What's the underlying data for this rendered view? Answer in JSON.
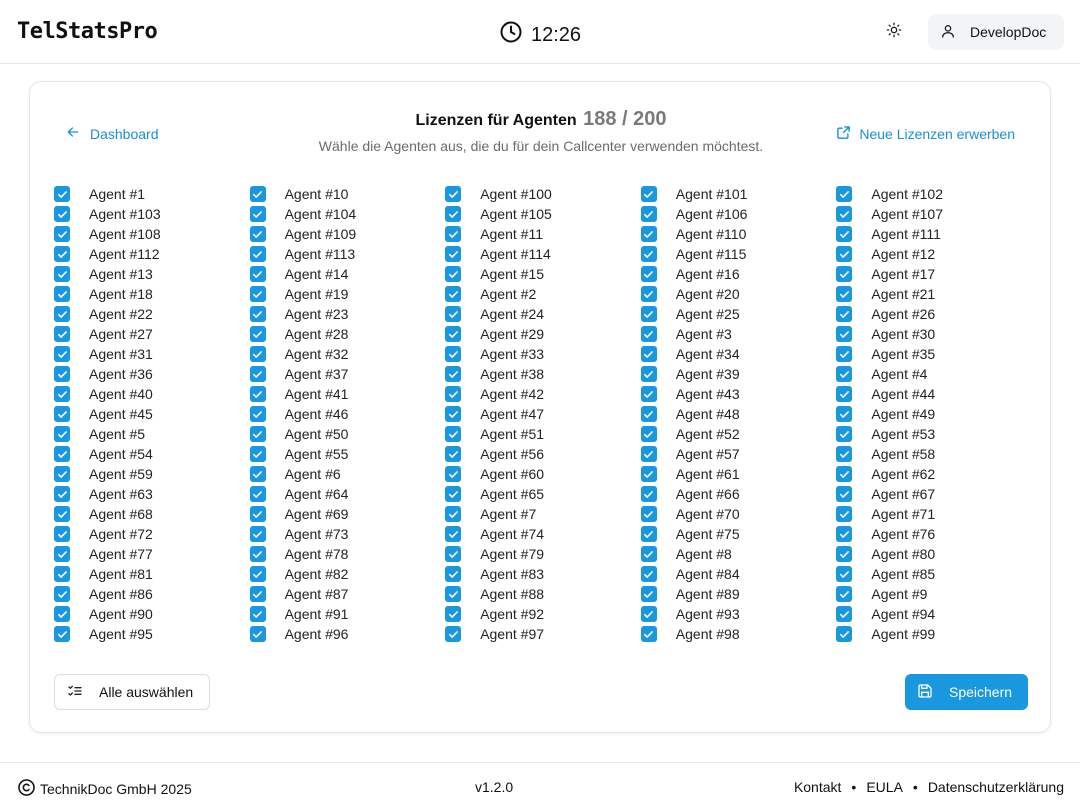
{
  "header": {
    "brand": "TelStatsPro",
    "time": "12:26",
    "user": "DevelopDoc"
  },
  "page": {
    "back_label": "Dashboard",
    "title": "Lizenzen für Agenten",
    "count": "188 / 200",
    "subtitle": "Wähle die Agenten aus, die du für dein Callcenter verwenden möchtest.",
    "buy_label": "Neue Lizenzen erwerben",
    "select_all_label": "Alle auswählen",
    "save_label": "Speichern"
  },
  "agents": [
    {
      "label": "Agent #1",
      "checked": true
    },
    {
      "label": "Agent #10",
      "checked": true
    },
    {
      "label": "Agent #100",
      "checked": true
    },
    {
      "label": "Agent #101",
      "checked": true
    },
    {
      "label": "Agent #102",
      "checked": true
    },
    {
      "label": "Agent #103",
      "checked": true
    },
    {
      "label": "Agent #104",
      "checked": true
    },
    {
      "label": "Agent #105",
      "checked": true
    },
    {
      "label": "Agent #106",
      "checked": true
    },
    {
      "label": "Agent #107",
      "checked": true
    },
    {
      "label": "Agent #108",
      "checked": true
    },
    {
      "label": "Agent #109",
      "checked": true
    },
    {
      "label": "Agent #11",
      "checked": true
    },
    {
      "label": "Agent #110",
      "checked": true
    },
    {
      "label": "Agent #111",
      "checked": true
    },
    {
      "label": "Agent #112",
      "checked": true
    },
    {
      "label": "Agent #113",
      "checked": true
    },
    {
      "label": "Agent #114",
      "checked": true
    },
    {
      "label": "Agent #115",
      "checked": true
    },
    {
      "label": "Agent #12",
      "checked": true
    },
    {
      "label": "Agent #13",
      "checked": true
    },
    {
      "label": "Agent #14",
      "checked": true
    },
    {
      "label": "Agent #15",
      "checked": true
    },
    {
      "label": "Agent #16",
      "checked": true
    },
    {
      "label": "Agent #17",
      "checked": true
    },
    {
      "label": "Agent #18",
      "checked": true
    },
    {
      "label": "Agent #19",
      "checked": true
    },
    {
      "label": "Agent #2",
      "checked": true
    },
    {
      "label": "Agent #20",
      "checked": true
    },
    {
      "label": "Agent #21",
      "checked": true
    },
    {
      "label": "Agent #22",
      "checked": true
    },
    {
      "label": "Agent #23",
      "checked": true
    },
    {
      "label": "Agent #24",
      "checked": true
    },
    {
      "label": "Agent #25",
      "checked": true
    },
    {
      "label": "Agent #26",
      "checked": true
    },
    {
      "label": "Agent #27",
      "checked": true
    },
    {
      "label": "Agent #28",
      "checked": true
    },
    {
      "label": "Agent #29",
      "checked": true
    },
    {
      "label": "Agent #3",
      "checked": true
    },
    {
      "label": "Agent #30",
      "checked": true
    },
    {
      "label": "Agent #31",
      "checked": true
    },
    {
      "label": "Agent #32",
      "checked": true
    },
    {
      "label": "Agent #33",
      "checked": true
    },
    {
      "label": "Agent #34",
      "checked": true
    },
    {
      "label": "Agent #35",
      "checked": true
    },
    {
      "label": "Agent #36",
      "checked": true
    },
    {
      "label": "Agent #37",
      "checked": true
    },
    {
      "label": "Agent #38",
      "checked": true
    },
    {
      "label": "Agent #39",
      "checked": true
    },
    {
      "label": "Agent #4",
      "checked": true
    },
    {
      "label": "Agent #40",
      "checked": true
    },
    {
      "label": "Agent #41",
      "checked": true
    },
    {
      "label": "Agent #42",
      "checked": true
    },
    {
      "label": "Agent #43",
      "checked": true
    },
    {
      "label": "Agent #44",
      "checked": true
    },
    {
      "label": "Agent #45",
      "checked": true
    },
    {
      "label": "Agent #46",
      "checked": true
    },
    {
      "label": "Agent #47",
      "checked": true
    },
    {
      "label": "Agent #48",
      "checked": true
    },
    {
      "label": "Agent #49",
      "checked": true
    },
    {
      "label": "Agent #5",
      "checked": true
    },
    {
      "label": "Agent #50",
      "checked": true
    },
    {
      "label": "Agent #51",
      "checked": true
    },
    {
      "label": "Agent #52",
      "checked": true
    },
    {
      "label": "Agent #53",
      "checked": true
    },
    {
      "label": "Agent #54",
      "checked": true
    },
    {
      "label": "Agent #55",
      "checked": true
    },
    {
      "label": "Agent #56",
      "checked": true
    },
    {
      "label": "Agent #57",
      "checked": true
    },
    {
      "label": "Agent #58",
      "checked": true
    },
    {
      "label": "Agent #59",
      "checked": true
    },
    {
      "label": "Agent #6",
      "checked": true
    },
    {
      "label": "Agent #60",
      "checked": true
    },
    {
      "label": "Agent #61",
      "checked": true
    },
    {
      "label": "Agent #62",
      "checked": true
    },
    {
      "label": "Agent #63",
      "checked": true
    },
    {
      "label": "Agent #64",
      "checked": true
    },
    {
      "label": "Agent #65",
      "checked": true
    },
    {
      "label": "Agent #66",
      "checked": true
    },
    {
      "label": "Agent #67",
      "checked": true
    },
    {
      "label": "Agent #68",
      "checked": true
    },
    {
      "label": "Agent #69",
      "checked": true
    },
    {
      "label": "Agent #7",
      "checked": true
    },
    {
      "label": "Agent #70",
      "checked": true
    },
    {
      "label": "Agent #71",
      "checked": true
    },
    {
      "label": "Agent #72",
      "checked": true
    },
    {
      "label": "Agent #73",
      "checked": true
    },
    {
      "label": "Agent #74",
      "checked": true
    },
    {
      "label": "Agent #75",
      "checked": true
    },
    {
      "label": "Agent #76",
      "checked": true
    },
    {
      "label": "Agent #77",
      "checked": true
    },
    {
      "label": "Agent #78",
      "checked": true
    },
    {
      "label": "Agent #79",
      "checked": true
    },
    {
      "label": "Agent #8",
      "checked": true
    },
    {
      "label": "Agent #80",
      "checked": true
    },
    {
      "label": "Agent #81",
      "checked": true
    },
    {
      "label": "Agent #82",
      "checked": true
    },
    {
      "label": "Agent #83",
      "checked": true
    },
    {
      "label": "Agent #84",
      "checked": true
    },
    {
      "label": "Agent #85",
      "checked": true
    },
    {
      "label": "Agent #86",
      "checked": true
    },
    {
      "label": "Agent #87",
      "checked": true
    },
    {
      "label": "Agent #88",
      "checked": true
    },
    {
      "label": "Agent #89",
      "checked": true
    },
    {
      "label": "Agent #9",
      "checked": true
    },
    {
      "label": "Agent #90",
      "checked": true
    },
    {
      "label": "Agent #91",
      "checked": true
    },
    {
      "label": "Agent #92",
      "checked": true
    },
    {
      "label": "Agent #93",
      "checked": true
    },
    {
      "label": "Agent #94",
      "checked": true
    },
    {
      "label": "Agent #95",
      "checked": true
    },
    {
      "label": "Agent #96",
      "checked": true
    },
    {
      "label": "Agent #97",
      "checked": true
    },
    {
      "label": "Agent #98",
      "checked": true
    },
    {
      "label": "Agent #99",
      "checked": true
    }
  ],
  "footer": {
    "copyright": "TechnikDoc GmbH 2025",
    "version": "v1.2.0",
    "links": [
      "Kontakt",
      "EULA",
      "Datenschutzerklärung"
    ],
    "separator": "•"
  },
  "colors": {
    "accent": "#1a98df",
    "link": "#1a8fd8"
  },
  "icons": {
    "clock": "clock-icon",
    "theme": "sun-icon",
    "user": "user-icon",
    "back": "arrow-left-icon",
    "external": "external-link-icon",
    "select_all": "list-checks-icon",
    "save": "save-icon",
    "copyright": "copyright-icon"
  }
}
